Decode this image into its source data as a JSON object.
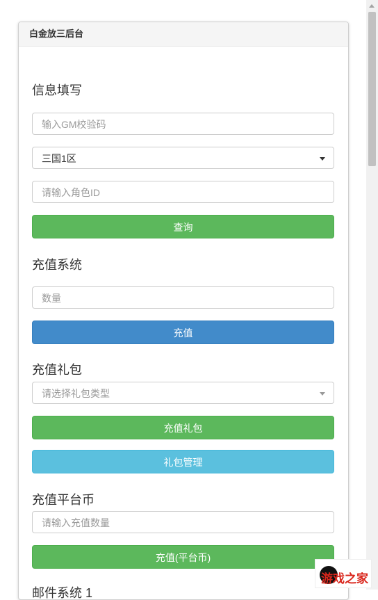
{
  "panel": {
    "title": "白金放三后台"
  },
  "info_section": {
    "title": "信息填写",
    "gm_code_placeholder": "输入GM校验码",
    "server_select_value": "三国1区",
    "role_id_placeholder": "请输入角色ID",
    "query_button": "查询"
  },
  "recharge_section": {
    "title": "充值系统",
    "amount_placeholder": "数量",
    "recharge_button": "充值"
  },
  "gift_section": {
    "title": "充值礼包",
    "gift_type_placeholder": "请选择礼包类型",
    "gift_recharge_button": "充值礼包",
    "gift_manage_button": "礼包管理"
  },
  "platform_section": {
    "title": "充值平台币",
    "amount_placeholder": "请输入充值数量",
    "recharge_button": "充值(平台币)"
  },
  "mail_section": {
    "title": "邮件系统 1"
  },
  "watermark": {
    "text": "游戏之家"
  },
  "colors": {
    "success": "#5cb85c",
    "primary": "#428bca",
    "info": "#5bc0de"
  }
}
